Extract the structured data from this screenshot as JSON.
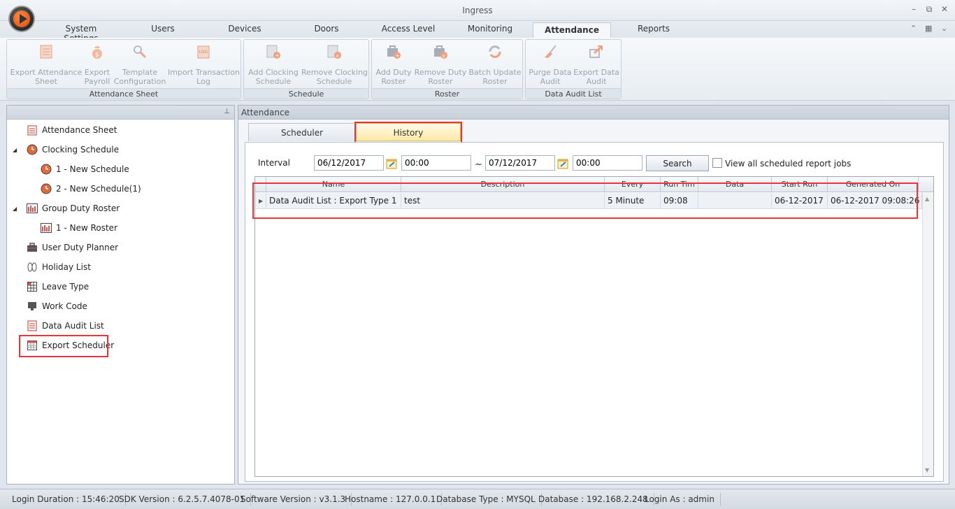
{
  "window": {
    "title": "Ingress"
  },
  "tabs": [
    {
      "label": "System Settings"
    },
    {
      "label": "Users"
    },
    {
      "label": "Devices"
    },
    {
      "label": "Doors"
    },
    {
      "label": "Access Level"
    },
    {
      "label": "Monitoring"
    },
    {
      "label": "Attendance"
    },
    {
      "label": "Reports"
    }
  ],
  "ribbon": {
    "groups": [
      {
        "label": "Attendance Sheet",
        "buttons": [
          {
            "line1": "Export Attendance",
            "line2": "Sheet",
            "icon": "sheet-icon"
          },
          {
            "line1": "Export",
            "line2": "Payroll",
            "icon": "money-bag-icon"
          },
          {
            "line1": "Template",
            "line2": "Configuration",
            "icon": "tools-icon"
          },
          {
            "line1": "Import Transaction",
            "line2": "Log",
            "icon": "log-icon"
          }
        ]
      },
      {
        "label": "Schedule",
        "buttons": [
          {
            "line1": "Add Clocking",
            "line2": "Schedule",
            "icon": "add-schedule-icon"
          },
          {
            "line1": "Remove Clocking",
            "line2": "Schedule",
            "icon": "remove-schedule-icon"
          }
        ]
      },
      {
        "label": "Roster",
        "buttons": [
          {
            "line1": "Add Duty",
            "line2": "Roster",
            "icon": "add-roster-icon"
          },
          {
            "line1": "Remove Duty",
            "line2": "Roster",
            "icon": "remove-roster-icon"
          },
          {
            "line1": "Batch Update",
            "line2": "Roster",
            "icon": "refresh-icon"
          }
        ]
      },
      {
        "label": "Data Audit List",
        "buttons": [
          {
            "line1": "Purge Data",
            "line2": "Audit",
            "icon": "broom-icon"
          },
          {
            "line1": "Export Data",
            "line2": "Audit",
            "icon": "export-arrow-icon"
          }
        ]
      }
    ]
  },
  "tree": [
    {
      "label": "Attendance Sheet",
      "icon": "sheet-icon"
    },
    {
      "label": "Clocking Schedule",
      "icon": "clock-icon"
    },
    {
      "label": "1 - New Schedule",
      "icon": "clock-icon"
    },
    {
      "label": "2 - New Schedule(1)",
      "icon": "clock-icon"
    },
    {
      "label": "Group Duty Roster",
      "icon": "roster-icon"
    },
    {
      "label": "1 - New Roster",
      "icon": "roster-icon"
    },
    {
      "label": "User Duty Planner",
      "icon": "briefcase-icon"
    },
    {
      "label": "Holiday List",
      "icon": "sandals-icon"
    },
    {
      "label": "Leave Type",
      "icon": "grid-icon"
    },
    {
      "label": "Work Code",
      "icon": "monitor-icon"
    },
    {
      "label": "Data Audit List",
      "icon": "list-icon"
    },
    {
      "label": "Export Scheduler",
      "icon": "calendar-icon"
    }
  ],
  "main": {
    "panel_title": "Attendance",
    "subtabs": [
      {
        "label": "Scheduler"
      },
      {
        "label": "History"
      }
    ],
    "filters": {
      "interval_label": "Interval",
      "from_date": "06/12/2017",
      "from_time": "00:00",
      "separator": "~",
      "to_date": "07/12/2017",
      "to_time": "00:00",
      "search_label": "Search",
      "view_all_label": "View all scheduled report jobs"
    },
    "grid": {
      "columns": [
        "Name",
        "Description",
        "Every",
        "Run Tim",
        "Data",
        "Start Run",
        "Generated On"
      ],
      "rows": [
        {
          "name": "Data Audit List : Export Type 1",
          "description": "test",
          "every": "5 Minute",
          "run_time": "09:08",
          "data": "",
          "start_run": "06-12-2017",
          "generated_on": "06-12-2017 09:08:26"
        }
      ]
    }
  },
  "status": [
    {
      "text": "Login Duration : 15:46:20"
    },
    {
      "text": "SDK Version : 6.2.5.7.4078-01"
    },
    {
      "text": "Software Version : v3.1.3"
    },
    {
      "text": "Hostname : 127.0.0.1"
    },
    {
      "text": "Database Type : MYSQL"
    },
    {
      "text": "Database : 192.168.2.248"
    },
    {
      "text": "Login As : admin"
    }
  ],
  "colors": {
    "highlight": "#e8343a",
    "orb": "#e04a10",
    "active_subtab": "#ffe9a6"
  }
}
